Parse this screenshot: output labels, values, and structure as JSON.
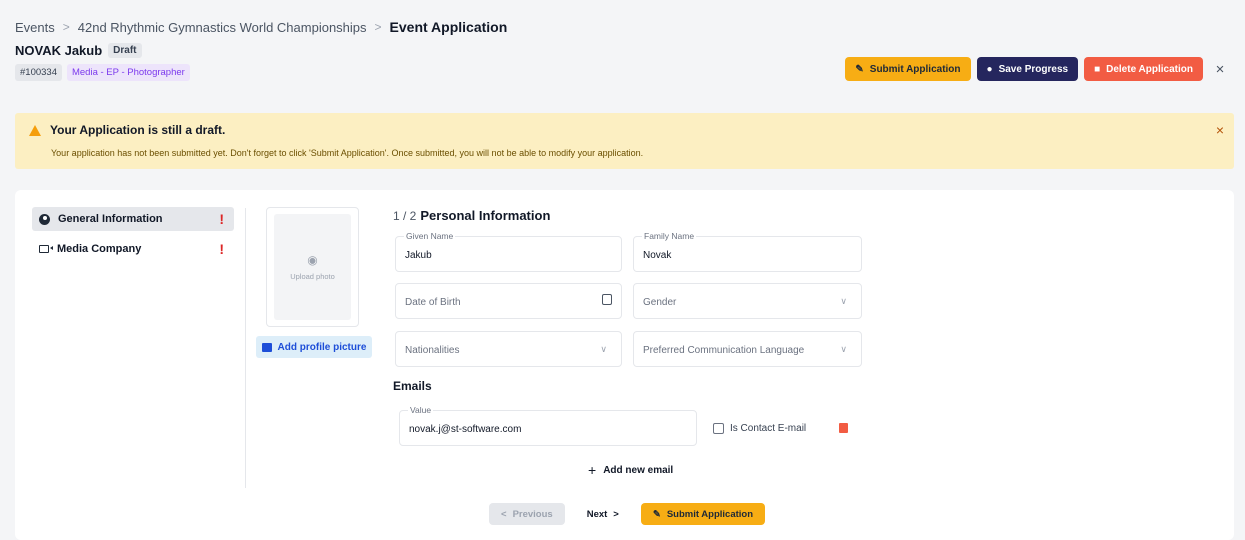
{
  "breadcrumb": {
    "items": [
      "Events",
      "42nd Rhythmic Gymnastics World Championships"
    ],
    "current": "Event Application",
    "separator": ">"
  },
  "applicant": {
    "name": "NOVAK Jakub",
    "status": "Draft",
    "id_tag": "#100334",
    "category_tag": "Media - EP - Photographer"
  },
  "actions": {
    "submit": "Submit Application",
    "save": "Save Progress",
    "delete": "Delete Application",
    "close": "×"
  },
  "alert": {
    "title": "Your Application is still a draft.",
    "message": "Your application has not been submitted yet. Don't forget to click 'Submit Application'. Once submitted, you will not be able to modify your application.",
    "close": "×"
  },
  "sidebar": {
    "items": [
      {
        "label": "General Information",
        "flag": "!"
      },
      {
        "label": "Media Company",
        "flag": "!"
      }
    ]
  },
  "photo": {
    "upload_text": "Upload photo",
    "add_button": "Add profile picture"
  },
  "form": {
    "step": "1 / 2",
    "title": "Personal Information",
    "given_name": {
      "label": "Given Name",
      "value": "Jakub"
    },
    "family_name": {
      "label": "Family Name",
      "value": "Novak"
    },
    "date_of_birth": {
      "placeholder": "Date of Birth"
    },
    "gender": {
      "placeholder": "Gender"
    },
    "nationalities": {
      "placeholder": "Nationalities"
    },
    "language": {
      "placeholder": "Preferred Communication Language"
    },
    "emails_title": "Emails",
    "email": {
      "label": "Value",
      "value": "novak.j@st-software.com"
    },
    "contact_label": "Is Contact E-mail",
    "add_email": "Add new email"
  },
  "nav": {
    "previous": "Previous",
    "next": "Next",
    "submit": "Submit Application"
  },
  "colors": {
    "submit": "#f7ad14",
    "save": "#25265e",
    "delete": "#f25c43",
    "alert_bg": "#fcefc2",
    "tag_purple": "#7c3aed"
  }
}
